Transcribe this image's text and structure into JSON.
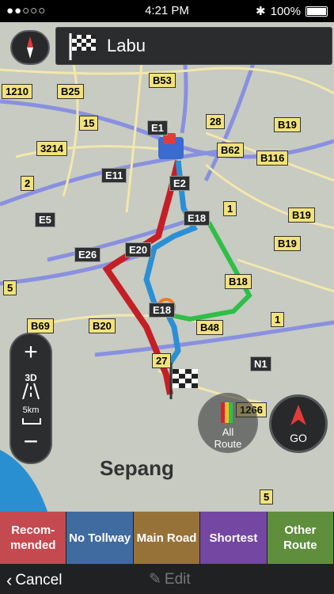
{
  "status_bar": {
    "signal": "●●○○○",
    "time": "4:21 PM",
    "battery": "100%"
  },
  "destination": {
    "name": "Labu"
  },
  "map": {
    "place_label": "Sepang",
    "road_labels": [
      "B53",
      "B25",
      "1210",
      "15",
      "3214",
      "E1",
      "28",
      "B19",
      "B62",
      "B116",
      "E11",
      "E2",
      "2",
      "E5",
      "1",
      "B19",
      "E18",
      "E26",
      "E20",
      "B19",
      "5",
      "B18",
      "B69",
      "B20",
      "B48",
      "1",
      "E18",
      "N1",
      "27",
      "1266",
      "5"
    ],
    "route_colors": {
      "recommended": "#d9232b",
      "no_tollway": "#2b8fd6",
      "shortest": "#8b3fb5",
      "other_route": "#2fbf48"
    }
  },
  "zoom_control": {
    "plus": "+",
    "mode": "3D",
    "scale": "5km",
    "minus": "−"
  },
  "all_route_button": {
    "line1": "All",
    "line2": "Route"
  },
  "go_button": {
    "label": "GO"
  },
  "route_tabs": [
    {
      "label": "Recom-mended",
      "color": "#c44a50"
    },
    {
      "label": "No Tollway",
      "color": "#3f6ba0"
    },
    {
      "label": "Main Road",
      "color": "#977238"
    },
    {
      "label": "Shortest",
      "color": "#7347a2"
    },
    {
      "label": "Other Route",
      "color": "#5f8f3d"
    }
  ],
  "bottom_bar": {
    "cancel": "Cancel",
    "edit": "Edit"
  }
}
